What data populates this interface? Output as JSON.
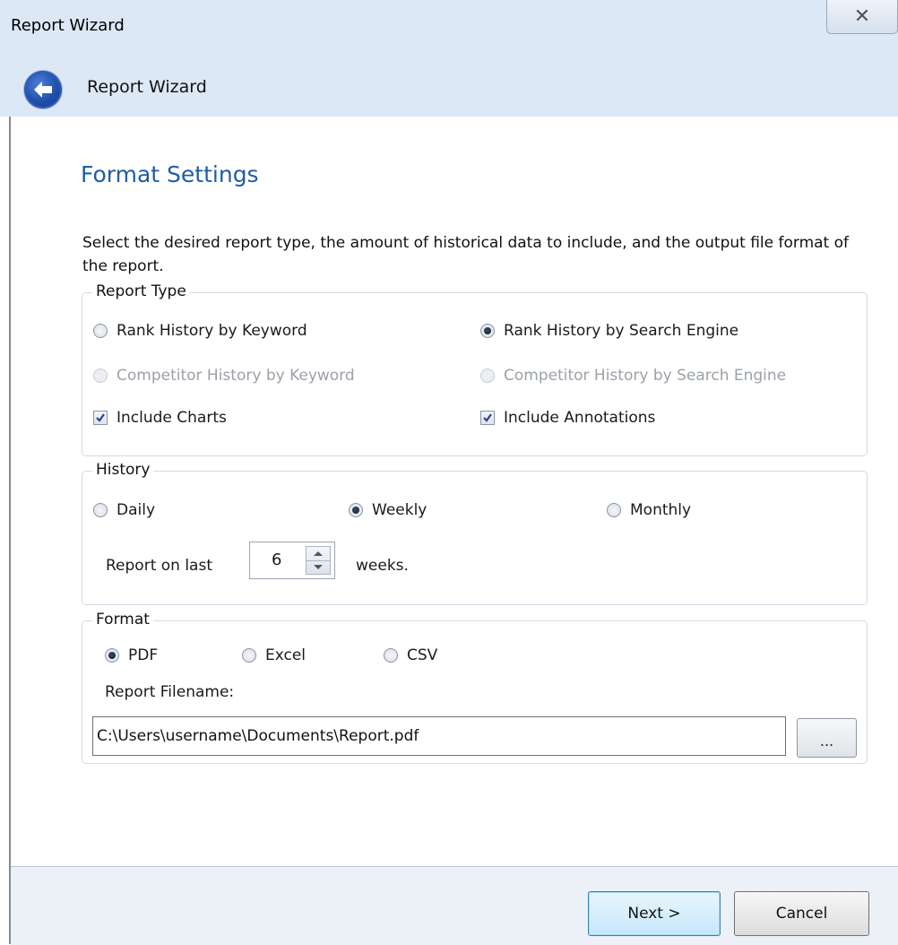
{
  "window": {
    "title": "Report Wizard",
    "close_glyph": "✕"
  },
  "nav": {
    "title": "Report Wizard",
    "back_icon": "back-arrow-icon"
  },
  "page": {
    "heading": "Format Settings",
    "description": "Select the desired report type, the amount of historical data to include, and the output file format of the report."
  },
  "report_type": {
    "legend": "Report Type",
    "options": [
      {
        "label": "Rank History by Keyword",
        "checked": false,
        "disabled": false
      },
      {
        "label": "Rank History by Search Engine",
        "checked": true,
        "disabled": false
      },
      {
        "label": "Competitor History by Keyword",
        "checked": false,
        "disabled": true
      },
      {
        "label": "Competitor History by Search Engine",
        "checked": false,
        "disabled": true
      }
    ],
    "include_charts": {
      "label": "Include Charts",
      "checked": true
    },
    "include_annotations": {
      "label": "Include Annotations",
      "checked": true
    }
  },
  "history": {
    "legend": "History",
    "options": [
      {
        "label": "Daily",
        "checked": false
      },
      {
        "label": "Weekly",
        "checked": true
      },
      {
        "label": "Monthly",
        "checked": false
      }
    ],
    "report_on_last_label": "Report on last",
    "count": "6",
    "unit_label": "weeks."
  },
  "format": {
    "legend": "Format",
    "options": [
      {
        "label": "PDF",
        "checked": true
      },
      {
        "label": "Excel",
        "checked": false
      },
      {
        "label": "CSV",
        "checked": false
      }
    ],
    "filename_label": "Report Filename:",
    "filename_value": "C:\\Users\\username\\Documents\\Report.pdf",
    "browse_label": "..."
  },
  "footer": {
    "next_label": "Next >",
    "cancel_label": "Cancel"
  },
  "colors": {
    "heading": "#1f5da8",
    "titlebar": "#dce8f6",
    "footer": "#ecf1f8"
  }
}
